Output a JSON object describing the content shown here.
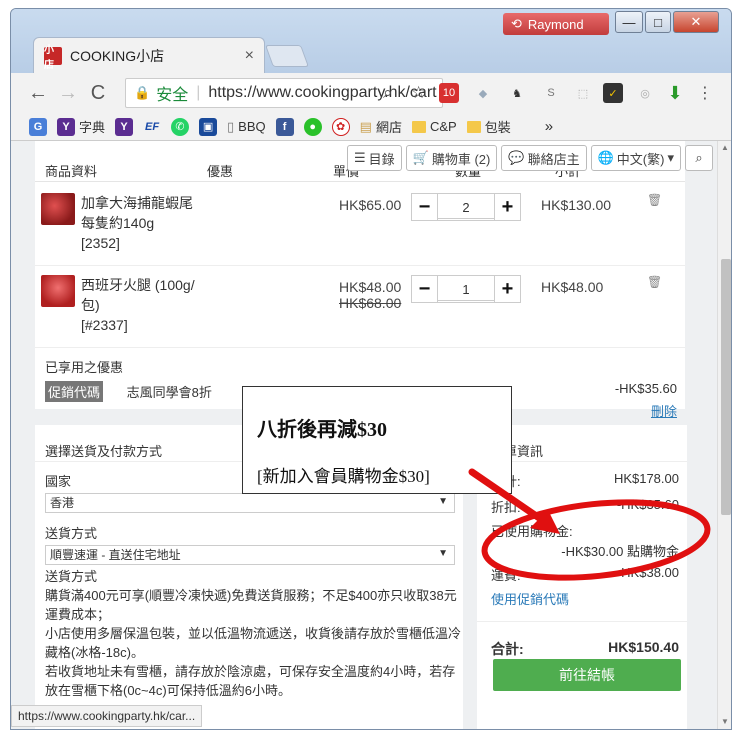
{
  "window": {
    "user_name": "Raymond",
    "min_glyph": "—",
    "max_glyph": "□",
    "close_glyph": "✕"
  },
  "tab": {
    "favicon_text": "小店",
    "title": "COOKING小店",
    "close_glyph": "×"
  },
  "toolbar": {
    "back": "←",
    "forward": "→",
    "reload": "C",
    "secure_label": "安全",
    "url": "https://www.cookingparty.hk/cart",
    "badge_count": "10"
  },
  "bookmarks": {
    "items": [
      "字典",
      "BBQ",
      "網店",
      "C&P",
      "包裝"
    ],
    "overflow": "»"
  },
  "header_nav": {
    "catalog": "目錄",
    "cart": "購物車 (2)",
    "contact": "聯絡店主",
    "language": "中文(繁)"
  },
  "cart_table": {
    "col_product": "商品資料",
    "col_discount": "優惠",
    "col_unit_price": "單價",
    "col_qty": "數量",
    "col_subtotal": "小計"
  },
  "cart_items": [
    {
      "name": "加拿大海捕龍蝦尾 每隻約140g",
      "code": "[2352]",
      "price": "HK$65.00",
      "old_price": "",
      "qty": "2",
      "subtotal": "HK$130.00"
    },
    {
      "name": "西班牙火腿 (100g/包)",
      "code": "[#2337]",
      "price": "HK$48.00",
      "old_price": "HK$68.00",
      "qty": "1",
      "subtotal": "HK$48.00"
    }
  ],
  "promo": {
    "heading": "已享用之優惠",
    "tag": "促銷代碼",
    "name": "志風同學會8折",
    "amount": "-HK$35.60",
    "delete_label": "刪除"
  },
  "shipping": {
    "heading": "選擇送貨及付款方式",
    "country_label": "國家",
    "country_value": "香港",
    "method_label": "送貨方式",
    "method_value": "順豐速運 - 直送住宅地址",
    "info_heading": "送貨方式",
    "info_lines": [
      "購貨滿400元可享(順豐冷凍快遞)免費送貨服務；不足$400亦只收取38元運費成本；",
      "小店使用多層保溫包裝，並以低溫物流遞送，收貨後請存放於雪櫃低溫冷藏格(冰格-18c)。",
      "若收貨地址未有雪櫃，請存放於陰涼處，可保存安全溫度約4小時，若存放在雪櫃下格(0c~4c)可保持低溫約6小時。"
    ]
  },
  "summary": {
    "heading": "訂單資訊",
    "subtotal_label": "小計:",
    "subtotal": "HK$178.00",
    "discount_label": "折扣:",
    "discount": "-HK$35.60",
    "points_label": "已使用購物金:",
    "points": "-HK$30.00 點購物金",
    "shipping_label": "運費:",
    "shipping": "HK$38.00",
    "promo_link": "使用促銷代碼",
    "total_label": "合計:",
    "total": "HK$150.40",
    "checkout_label": "前往結帳"
  },
  "status_bar": "https://www.cookingparty.hk/car...",
  "callout": {
    "line1": "八折後再減$30",
    "line2": "[新加入會員購物金$30]"
  },
  "colors": {
    "accent_red": "#e01010",
    "checkout_green": "#4fad4f",
    "link_blue": "#2a7ab8"
  }
}
